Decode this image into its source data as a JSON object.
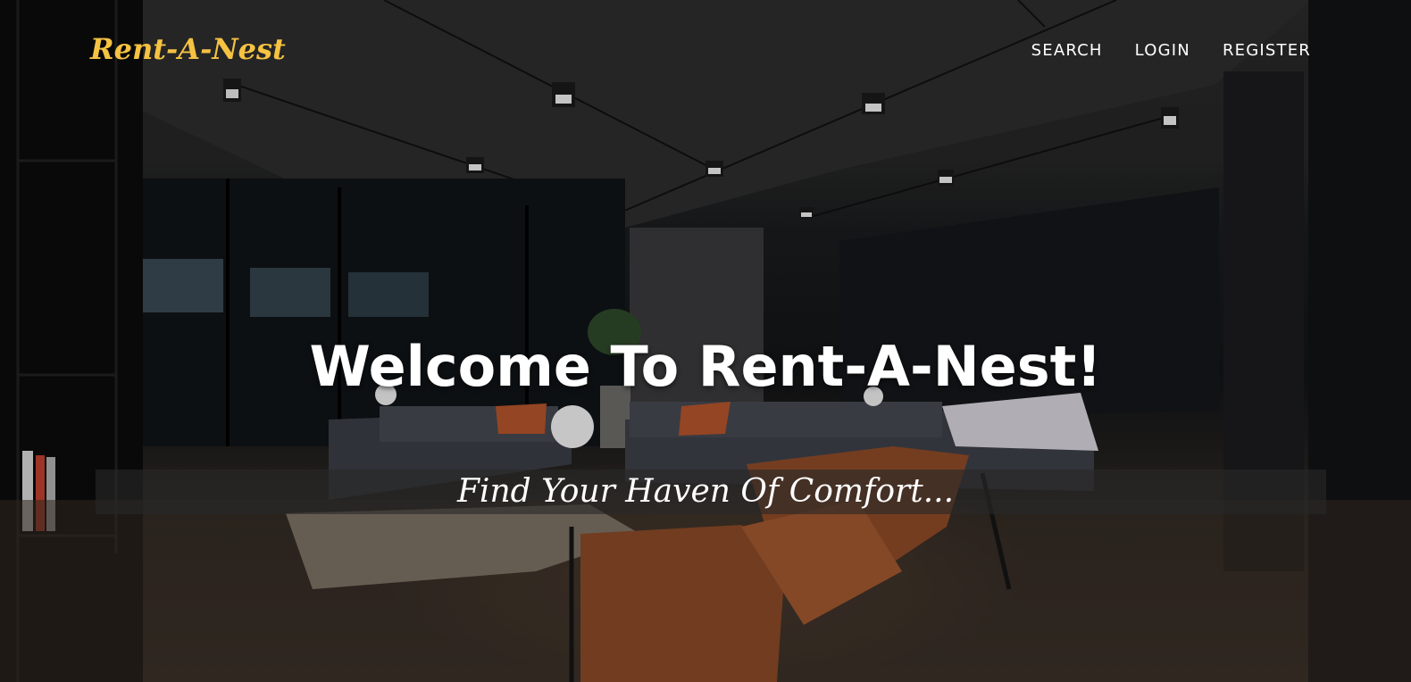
{
  "brand": {
    "name": "Rent-A-Nest",
    "color": "#f5c242"
  },
  "nav": {
    "items": [
      {
        "label": "SEARCH"
      },
      {
        "label": "LOGIN"
      },
      {
        "label": "REGISTER"
      }
    ]
  },
  "hero": {
    "headline": "Welcome To Rent-A-Nest!",
    "tagline": "Find Your Haven Of Comfort...",
    "background_image": "dark-loft-living-room-photo"
  }
}
